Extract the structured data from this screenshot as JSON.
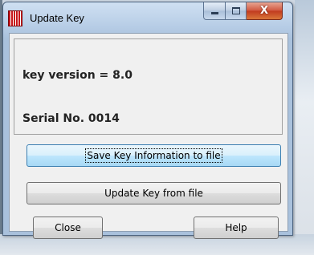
{
  "window": {
    "title": "Update Key",
    "close_glyph": "X"
  },
  "info": {
    "key_version": "key version =  8.0",
    "serial": "Serial No. 0014"
  },
  "buttons": {
    "save_key": "Save Key Information to file",
    "update_key": "Update Key from file",
    "close": "Close",
    "help": "Help"
  }
}
